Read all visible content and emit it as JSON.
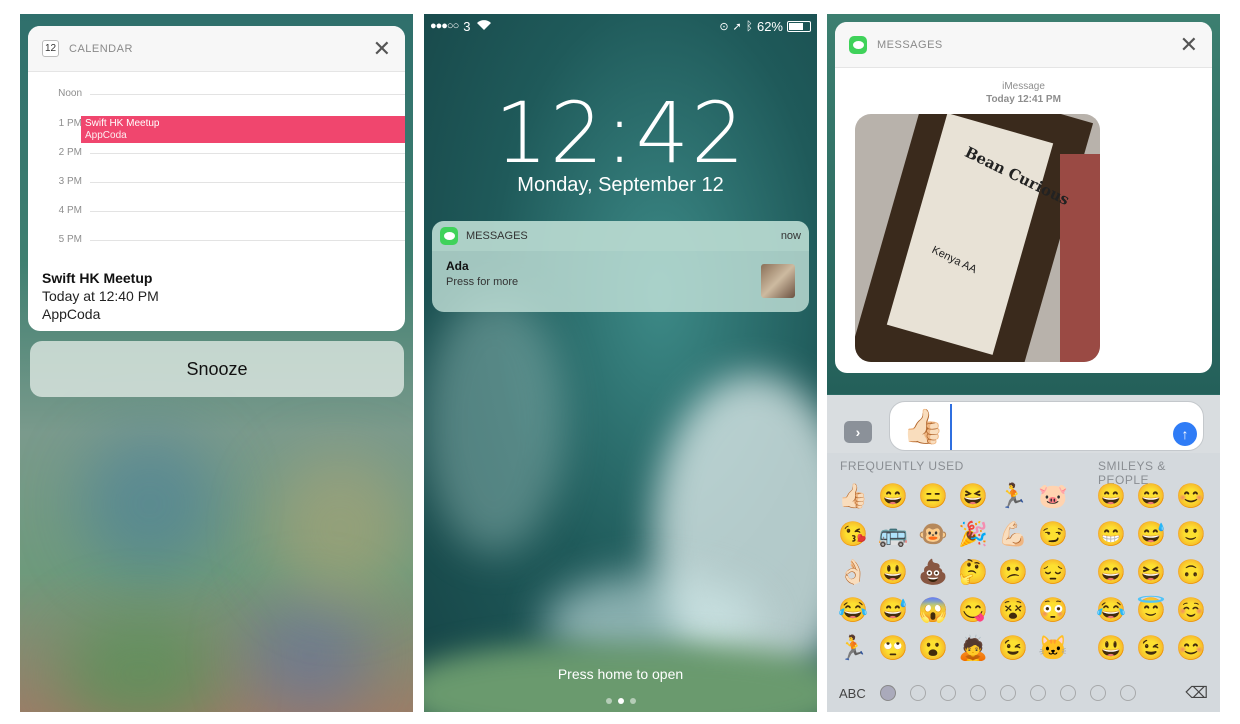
{
  "calendar": {
    "app_name": "CALENDAR",
    "icon_day": "12",
    "timeline": [
      "Noon",
      "1 PM",
      "2 PM",
      "3 PM",
      "4 PM",
      "5 PM"
    ],
    "event_title": "Swift HK Meetup",
    "event_location": "AppCoda",
    "detail_title": "Swift HK Meetup",
    "detail_time": "Today at 12:40 PM",
    "detail_location": "AppCoda",
    "snooze_label": "Snooze"
  },
  "lockscreen": {
    "carrier": "3",
    "battery": "62%",
    "time": "12:42",
    "date": "Monday, September 12",
    "notification": {
      "app": "MESSAGES",
      "when": "now",
      "sender": "Ada",
      "subtitle": "Press for more"
    },
    "press_home": "Press home to open"
  },
  "messages": {
    "app_name": "MESSAGES",
    "service": "iMessage",
    "timestamp": "Today 12:41 PM",
    "photo_brand": "Bean Curious",
    "photo_label": "Kenya AA",
    "input_emoji": "👍🏻",
    "keyboard": {
      "section_frequent": "FREQUENTLY USED",
      "section_smileys": "SMILEYS & PEOPLE",
      "abc_label": "ABC",
      "frequent": [
        "👍🏻",
        "😄",
        "😑",
        "😆",
        "🏃",
        "🐷",
        "😘",
        "🚌",
        "🐵",
        "🎉",
        "💪🏻",
        "😏",
        "👌🏻",
        "😃",
        "💩",
        "🤔",
        "😕",
        "😔",
        "😂",
        "😅",
        "😱",
        "😋",
        "😵",
        "😳",
        "🏃",
        "🙄",
        "😮",
        "🙇",
        "😉",
        "🐱"
      ],
      "smileys": [
        "😄",
        "😄",
        "😊",
        "😁",
        "😅",
        "🙂",
        "😄",
        "😆",
        "🙃",
        "😂",
        "😇",
        "☺️",
        "😃",
        "😉",
        "😊"
      ]
    }
  }
}
